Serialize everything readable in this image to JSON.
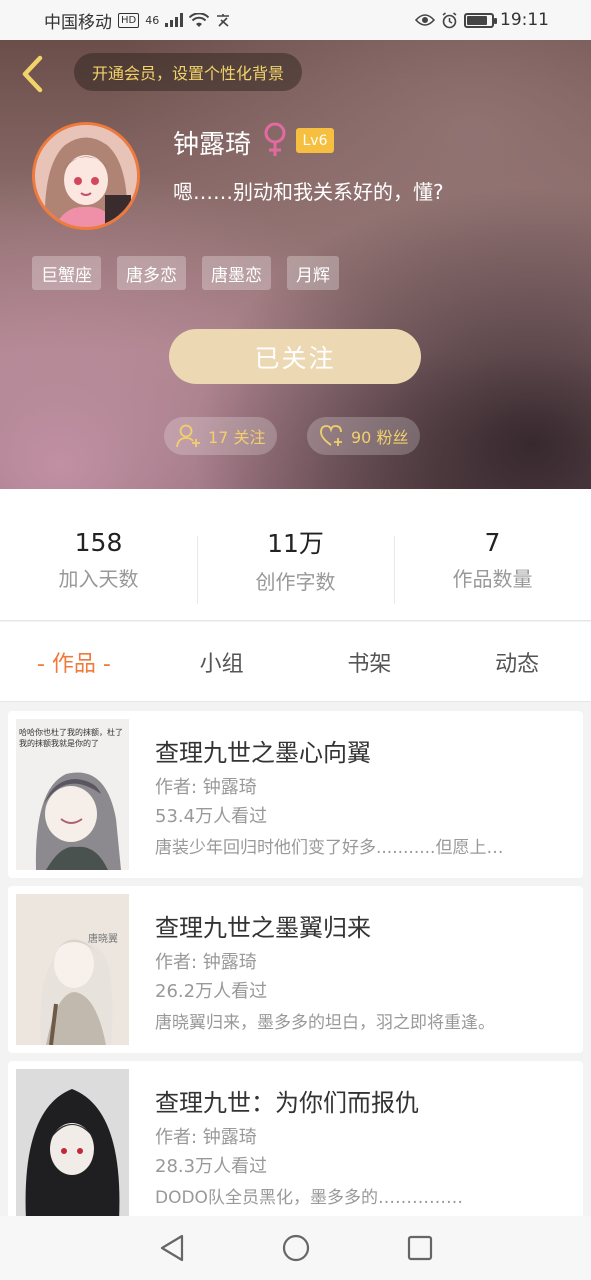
{
  "status_bar": {
    "carrier": "中国移动",
    "hd": "HD",
    "network": "46",
    "time": "19:11",
    "battery_level": 0.75
  },
  "header": {
    "vip_prompt": "开通会员，设置个性化背景",
    "user_name": "钟露琦",
    "level": "Lv6",
    "signature": "嗯……别动和我关系好的，懂?",
    "tags": [
      "巨蟹座",
      "唐多恋",
      "唐墨恋",
      "月辉"
    ],
    "follow_button": "已关注",
    "following_label": "17 关注",
    "fans_label": "90 粉丝"
  },
  "stats": [
    {
      "value": "158",
      "label": "加入天数"
    },
    {
      "value": "11万",
      "label": "创作字数"
    },
    {
      "value": "7",
      "label": "作品数量"
    }
  ],
  "tabs": [
    "- 作品 -",
    "小组",
    "书架",
    "动态"
  ],
  "books": [
    {
      "title": "查理九世之墨心向翼",
      "author": "作者: 钟露琦",
      "views": "53.4万人看过",
      "description": "唐装少年回归时他们变了好多...........但愿上…",
      "cover_text": "哈哈你也杜了我的抹额，杜了我的抹额我就是你的了"
    },
    {
      "title": "查理九世之墨翼归来",
      "author": "作者: 钟露琦",
      "views": "26.2万人看过",
      "description": "唐晓翼归来，墨多多的坦白，羽之即将重逢。",
      "cover_text": "唐晓翼"
    },
    {
      "title": "查理九世：为你们而报仇",
      "author": "作者: 钟露琦",
      "views": "28.3万人看过",
      "description": "DODO队全员黑化，墨多多的……………"
    }
  ],
  "colors": {
    "accent": "#f07a3c",
    "gold": "#f1d36a",
    "follow_button": "#ecd9b3",
    "level_badge": "#f6bf3f"
  }
}
